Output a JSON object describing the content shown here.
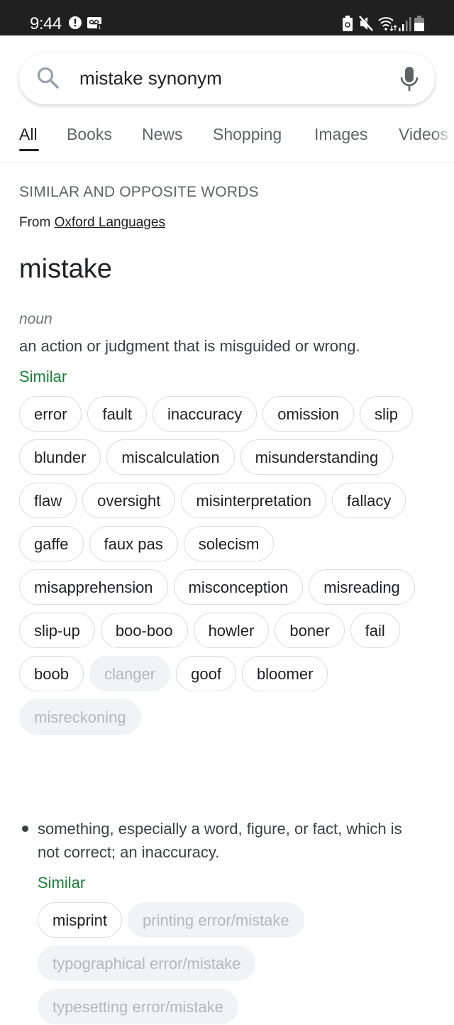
{
  "status_bar": {
    "time": "9:44",
    "left_icons": [
      "alert-icon",
      "voicemail-icon"
    ],
    "right_icons": [
      "battery-saver-icon",
      "mute-icon",
      "wifi-icon",
      "signal-icon",
      "battery-icon"
    ]
  },
  "search": {
    "query": "mistake synonym",
    "left_icon": "search-icon",
    "right_icon": "mic-icon"
  },
  "tabs": [
    {
      "label": "All",
      "active": true
    },
    {
      "label": "Books",
      "active": false
    },
    {
      "label": "News",
      "active": false
    },
    {
      "label": "Shopping",
      "active": false
    },
    {
      "label": "Images",
      "active": false
    },
    {
      "label": "Videos",
      "active": false
    }
  ],
  "card": {
    "section_title": "SIMILAR AND OPPOSITE WORDS",
    "source_prefix": "From",
    "source_link": "Oxford Languages",
    "word": "mistake",
    "part_of_speech": "noun",
    "senses": [
      {
        "definition": "an action or judgment that is misguided or wrong.",
        "similar_label": "Similar",
        "chips": [
          {
            "label": "error",
            "enabled": true
          },
          {
            "label": "fault",
            "enabled": true
          },
          {
            "label": "inaccuracy",
            "enabled": true
          },
          {
            "label": "omission",
            "enabled": true
          },
          {
            "label": "slip",
            "enabled": true
          },
          {
            "label": "blunder",
            "enabled": true
          },
          {
            "label": "miscalculation",
            "enabled": true
          },
          {
            "label": "misunderstanding",
            "enabled": true
          },
          {
            "label": "flaw",
            "enabled": true
          },
          {
            "label": "oversight",
            "enabled": true
          },
          {
            "label": "misinterpretation",
            "enabled": true
          },
          {
            "label": "fallacy",
            "enabled": true
          },
          {
            "label": "gaffe",
            "enabled": true
          },
          {
            "label": "faux pas",
            "enabled": true
          },
          {
            "label": "solecism",
            "enabled": true
          },
          {
            "label": "misapprehension",
            "enabled": true
          },
          {
            "label": "misconception",
            "enabled": true
          },
          {
            "label": "misreading",
            "enabled": true
          },
          {
            "label": "slip-up",
            "enabled": true
          },
          {
            "label": "boo-boo",
            "enabled": true
          },
          {
            "label": "howler",
            "enabled": true
          },
          {
            "label": "boner",
            "enabled": true
          },
          {
            "label": "fail",
            "enabled": true
          },
          {
            "label": "boob",
            "enabled": true
          },
          {
            "label": "clanger",
            "enabled": false
          },
          {
            "label": "goof",
            "enabled": true
          },
          {
            "label": "bloomer",
            "enabled": true
          },
          {
            "label": "misreckoning",
            "enabled": false
          }
        ]
      },
      {
        "definition": "something, especially a word, figure, or fact, which is not correct; an inaccuracy.",
        "similar_label": "Similar",
        "chips": [
          {
            "label": "misprint",
            "enabled": true
          },
          {
            "label": "printing error/mistake",
            "enabled": false
          },
          {
            "label": "typographical error/mistake",
            "enabled": false
          },
          {
            "label": "typesetting error/mistake",
            "enabled": false
          }
        ]
      }
    ]
  }
}
